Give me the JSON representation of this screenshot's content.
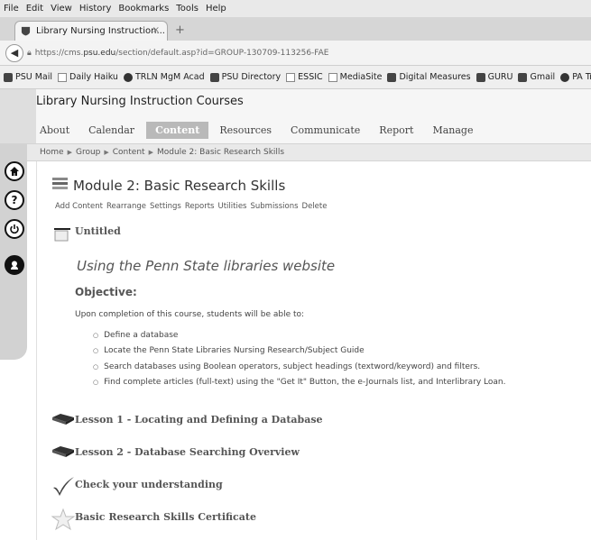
{
  "browser": {
    "menu": [
      "File",
      "Edit",
      "View",
      "History",
      "Bookmarks",
      "Tools",
      "Help"
    ],
    "tab_title": "Library Nursing Instruction...",
    "tab_close": "×",
    "new_tab": "+",
    "url_prefix": "https://cms.",
    "url_domain": "psu.edu",
    "url_rest": "/section/default.asp?id=GROUP-130709-113256-FAE",
    "bookmarks": [
      "PSU Mail",
      "Daily Haiku",
      "TRLN MgM Acad",
      "PSU Directory",
      "ESSIC",
      "MediaSite",
      "Digital Measures",
      "GURU",
      "Gmail",
      "PA Traffic"
    ]
  },
  "site": {
    "title": "Library Nursing Instruction Courses",
    "nav": [
      "About",
      "Calendar",
      "Content",
      "Resources",
      "Communicate",
      "Report",
      "Manage"
    ],
    "active_nav": "Content",
    "breadcrumb": [
      "Home",
      "Group",
      "Content",
      "Module 2: Basic Research Skills"
    ]
  },
  "module": {
    "title": "Module 2: Basic Research Skills",
    "actions": [
      "Add Content",
      "Rearrange",
      "Settings",
      "Reports",
      "Utilities",
      "Submissions",
      "Delete"
    ],
    "untitled": "Untitled",
    "heading": "Using the Penn State libraries website",
    "objective_label": "Objective:",
    "intro": "Upon completion of this course, students will be able to:",
    "objectives": [
      "Define a database",
      "Locate the Penn State Libraries Nursing Research/Subject Guide",
      "Search databases using Boolean operators, subject headings (textword/keyword) and filters.",
      "Find complete articles (full-text) using the \"Get It\" Button, the e-Journals list, and Interlibrary Loan."
    ],
    "items": [
      {
        "label": "Lesson 1 - Locating and Defining a Database",
        "icon": "book-icon"
      },
      {
        "label": "Lesson 2 - Database Searching Overview",
        "icon": "book-icon"
      },
      {
        "label": "Check your understanding",
        "icon": "checkmark-icon"
      },
      {
        "label": "Basic Research Skills Certificate",
        "icon": "star-icon"
      }
    ]
  }
}
